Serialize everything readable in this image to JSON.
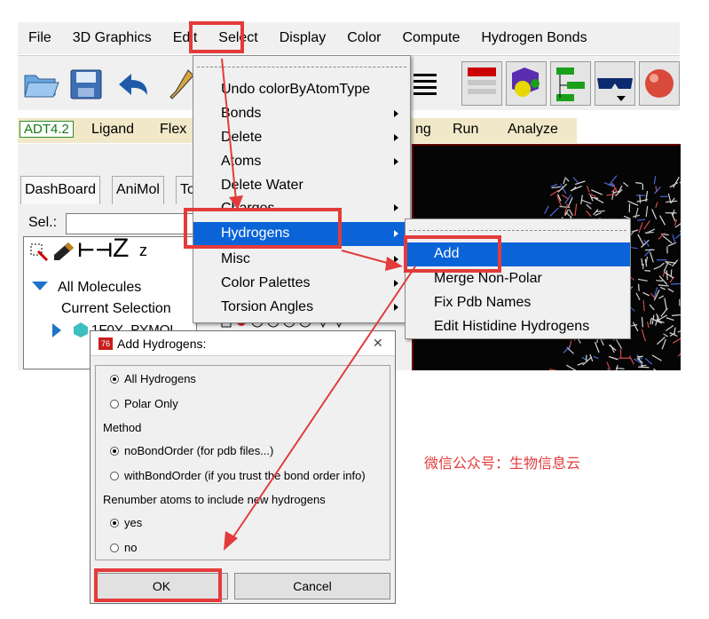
{
  "menubar": {
    "items": [
      "File",
      "3D Graphics",
      "Edit",
      "Select",
      "Display",
      "Color",
      "Compute",
      "Hydrogen Bonds"
    ]
  },
  "tabstrip": {
    "active": "ADT4.2",
    "items": [
      "Ligand",
      "Flex",
      "ng",
      "Run",
      "Analyze"
    ]
  },
  "leftpanel": {
    "tabs": [
      "DashBoard",
      "AniMol",
      "To"
    ],
    "sel_label": "Sel.:",
    "tree_root": "All Molecules",
    "current_selection": "Current Selection",
    "partial_row": "1F0Y_PYMOL"
  },
  "edit_menu": {
    "items": [
      "Undo colorByAtomType",
      "Bonds",
      "Delete",
      "Atoms",
      "Delete Water",
      "Charges",
      "Hydrogens",
      "Misc",
      "Color Palettes",
      "Torsion Angles"
    ],
    "selected": "Hydrogens"
  },
  "hydrogens_submenu": {
    "items": [
      "Add",
      "Merge Non-Polar",
      "Fix Pdb Names",
      "Edit Histidine Hydrogens"
    ],
    "selected": "Add"
  },
  "dialog": {
    "title": "Add Hydrogens:",
    "close": "✕",
    "opt_all": "All Hydrogens",
    "opt_polar": "Polar Only",
    "method_label": "Method",
    "opt_nobond": "noBondOrder (for pdb files...)",
    "opt_withbond": "withBondOrder (if you trust the bond order info)",
    "renumber_label": "Renumber atoms to include new hydrogens",
    "opt_yes": "yes",
    "opt_no": "no",
    "ok": "OK",
    "cancel": "Cancel"
  },
  "watermark": "微信公众号：生物信息云",
  "colors": {
    "highlight": "#0a64d8",
    "annotation_red": "#e33b3b",
    "viewer_bg": "#050505",
    "tab_strip": "#f0e8c8"
  }
}
